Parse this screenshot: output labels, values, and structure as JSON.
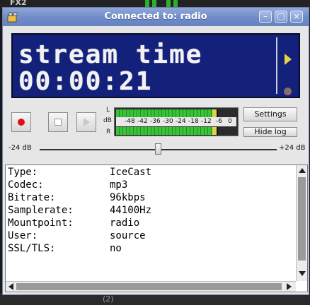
{
  "background": {
    "label": "FX2",
    "bottom_text": "(2)"
  },
  "window": {
    "title": "Connected to: radio",
    "buttons": {
      "minimize": "–",
      "maximize": "□",
      "close": "×"
    }
  },
  "display": {
    "line1": "stream time",
    "line2": "00:00:21"
  },
  "controls": {
    "record": "record-icon",
    "stop": "stop-icon",
    "play": "play-icon"
  },
  "meter": {
    "label_left": "L",
    "label_db": "dB",
    "label_right": "R",
    "scale": [
      "-48",
      "-42",
      "-36",
      "-30",
      "-24",
      "-18",
      "-12",
      "-6",
      "0"
    ],
    "left_level": 0.84,
    "right_level": 0.84
  },
  "buttons": {
    "settings": "Settings",
    "hide_log": "Hide log"
  },
  "volume": {
    "min_label": "-24 dB",
    "max_label": "+24 dB",
    "value": 0.5
  },
  "log": {
    "rows": [
      {
        "key": "Type:",
        "value": "IceCast"
      },
      {
        "key": "Codec:",
        "value": "mp3"
      },
      {
        "key": "Bitrate:",
        "value": "96kbps"
      },
      {
        "key": "Samplerate:",
        "value": "44100Hz"
      },
      {
        "key": "Mountpoint:",
        "value": "radio"
      },
      {
        "key": "User:",
        "value": "source"
      },
      {
        "key": "SSL/TLS:",
        "value": "no"
      }
    ]
  },
  "colors": {
    "display_bg": "#13217a",
    "titlebar": "#7590cb",
    "meter_green": "#3ac23a",
    "record_red": "#e01010"
  }
}
